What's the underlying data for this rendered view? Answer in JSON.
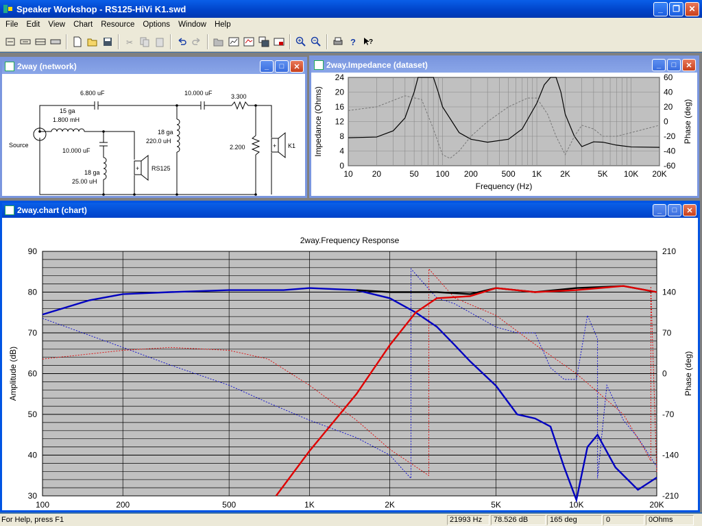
{
  "window": {
    "title": "Speaker Workshop - RS125-HiVi K1.swd"
  },
  "menu": [
    "File",
    "Edit",
    "View",
    "Chart",
    "Resource",
    "Options",
    "Window",
    "Help"
  ],
  "network": {
    "title": "2way (network)",
    "labels": {
      "c1": "6.800 uF",
      "ga1": "15 ga",
      "l1": "1.800 mH",
      "c2": "10.000 uF",
      "ga2": "18 ga",
      "l2": "25.00 uH",
      "ga3": "18 ga",
      "l3": "220.0 uH",
      "c3": "10.000 uF",
      "r1": "3.300",
      "r2": "2.200",
      "source": "Source",
      "drv1": "RS125",
      "drv2": "K1"
    }
  },
  "impedance": {
    "title": "2way.Impedance (dataset)",
    "ylabel": "Impedance (Ohms)",
    "y2label": "Phase (deg)",
    "xlabel": "Frequency (Hz)",
    "yticks": [
      "24",
      "20",
      "16",
      "12",
      "8",
      "4",
      "0"
    ],
    "y2ticks": [
      "60",
      "40",
      "20",
      "0",
      "-20",
      "-40",
      "-60"
    ],
    "xticks": [
      "10",
      "20",
      "50",
      "100",
      "200",
      "500",
      "1K",
      "2K",
      "5K",
      "10K",
      "20K"
    ]
  },
  "chart": {
    "title": "2way.chart (chart)",
    "plot_title": "2way.Frequency Response",
    "ylabel": "Amplitude (dB)",
    "y2label": "Phase (deg)",
    "xlabel": "Frequency (Hz)",
    "yticks": [
      "90",
      "80",
      "70",
      "60",
      "50",
      "40",
      "30"
    ],
    "y2ticks": [
      "210",
      "140",
      "70",
      "0",
      "-70",
      "-140",
      "-210"
    ],
    "xticks": [
      "100",
      "200",
      "500",
      "1K",
      "2K",
      "5K",
      "10K",
      "20K"
    ]
  },
  "chart_data": {
    "type": "line",
    "title": "2way.Frequency Response",
    "xlabel": "Frequency (Hz)",
    "ylabel": "Amplitude (dB)",
    "xscale": "log",
    "xlim": [
      100,
      20000
    ],
    "ylim": [
      30,
      90
    ],
    "y2lim": [
      -210,
      210
    ],
    "series": [
      {
        "color": "#0000c0",
        "x": [
          100,
          150,
          200,
          300,
          500,
          800,
          1000,
          1500,
          2000,
          2500,
          3000,
          3500,
          4000,
          5000,
          6000,
          7000,
          8000,
          9000,
          10000,
          11000,
          12000,
          14000,
          17000,
          20000
        ],
        "y": [
          74.5,
          78,
          79.5,
          80,
          80.5,
          80.5,
          81,
          80.5,
          78.5,
          75,
          71.5,
          67,
          63,
          57,
          50,
          49,
          47,
          37,
          29,
          42,
          45,
          37,
          31.5,
          34.5
        ]
      },
      {
        "color": "#000000",
        "x": [
          1500,
          2000,
          2500,
          3000,
          4000,
          5000,
          7000,
          10000,
          15000,
          20000
        ],
        "y": [
          80.5,
          80,
          80,
          80,
          79.5,
          81,
          80,
          81,
          81.5,
          80
        ]
      },
      {
        "color": "#e00000",
        "x": [
          750,
          1000,
          1500,
          2000,
          2500,
          3000,
          4000,
          5000,
          7000,
          10000,
          15000,
          20000
        ],
        "y": [
          30,
          41,
          55,
          67,
          75,
          78.5,
          79,
          81,
          80,
          80.5,
          81.5,
          80
        ]
      }
    ]
  },
  "status": {
    "help": "For Help, press F1",
    "freq": "21993 Hz",
    "db": "78.526 dB",
    "deg": "165 deg",
    "val": "0",
    "ohms": "0Ohms"
  }
}
